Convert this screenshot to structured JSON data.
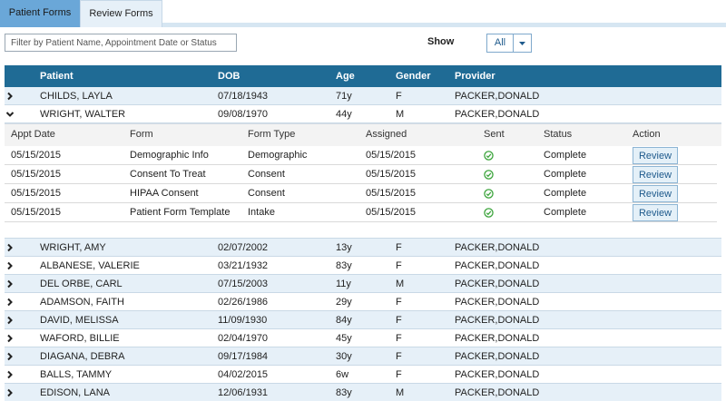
{
  "tabs": [
    {
      "label": "Patient Forms",
      "active": true
    },
    {
      "label": "Review Forms",
      "active": false
    }
  ],
  "filter": {
    "placeholder": "Filter by Patient Name, Appointment Date or Status",
    "value": ""
  },
  "show": {
    "label": "Show",
    "selected": "All"
  },
  "table": {
    "headers": {
      "patient": "Patient",
      "dob": "DOB",
      "age": "Age",
      "gender": "Gender",
      "provider": "Provider"
    },
    "rows_before": [
      {
        "patient": "CHILDS, LAYLA",
        "dob": "07/18/1943",
        "age": "71y",
        "gender": "F",
        "provider": "PACKER,DONALD",
        "expanded": false
      },
      {
        "patient": "WRIGHT, WALTER",
        "dob": "09/08/1970",
        "age": "44y",
        "gender": "M",
        "provider": "PACKER,DONALD",
        "expanded": true
      }
    ],
    "forms": {
      "headers": {
        "appt_date": "Appt Date",
        "form": "Form",
        "form_type": "Form Type",
        "assigned": "Assigned",
        "sent": "Sent",
        "status": "Status",
        "action": "Action"
      },
      "rows": [
        {
          "appt_date": "05/15/2015",
          "form": "Demographic Info",
          "form_type": "Demographic",
          "assigned": "05/15/2015",
          "status": "Complete",
          "action": "Review"
        },
        {
          "appt_date": "05/15/2015",
          "form": "Consent To Treat",
          "form_type": "Consent",
          "assigned": "05/15/2015",
          "status": "Complete",
          "action": "Review"
        },
        {
          "appt_date": "05/15/2015",
          "form": "HIPAA Consent",
          "form_type": "Consent",
          "assigned": "05/15/2015",
          "status": "Complete",
          "action": "Review"
        },
        {
          "appt_date": "05/15/2015",
          "form": "Patient Form Template",
          "form_type": "Intake",
          "assigned": "05/15/2015",
          "status": "Complete",
          "action": "Review"
        }
      ]
    },
    "rows_after": [
      {
        "patient": "WRIGHT, AMY",
        "dob": "02/07/2002",
        "age": "13y",
        "gender": "F",
        "provider": "PACKER,DONALD"
      },
      {
        "patient": "ALBANESE, VALERIE",
        "dob": "03/21/1932",
        "age": "83y",
        "gender": "F",
        "provider": "PACKER,DONALD"
      },
      {
        "patient": "DEL ORBE, CARL",
        "dob": "07/15/2003",
        "age": "11y",
        "gender": "M",
        "provider": "PACKER,DONALD"
      },
      {
        "patient": "ADAMSON, FAITH",
        "dob": "02/26/1986",
        "age": "29y",
        "gender": "F",
        "provider": "PACKER,DONALD"
      },
      {
        "patient": "DAVID, MELISSA",
        "dob": "11/09/1930",
        "age": "84y",
        "gender": "F",
        "provider": "PACKER,DONALD"
      },
      {
        "patient": "WAFORD, BILLIE",
        "dob": "02/04/1970",
        "age": "45y",
        "gender": "F",
        "provider": "PACKER,DONALD"
      },
      {
        "patient": "DIAGANA, DEBRA",
        "dob": "09/17/1984",
        "age": "30y",
        "gender": "F",
        "provider": "PACKER,DONALD"
      },
      {
        "patient": "BALLS, TAMMY",
        "dob": "04/02/2015",
        "age": "6w",
        "gender": "F",
        "provider": "PACKER,DONALD"
      },
      {
        "patient": "EDISON, LANA",
        "dob": "12/06/1931",
        "age": "83y",
        "gender": "M",
        "provider": "PACKER,DONALD"
      }
    ]
  },
  "colors": {
    "header_bg": "#1f6b95",
    "alt_row": "#e6f0f8",
    "sent_check": "#3aa33a",
    "active_tab": "#6aa7d8"
  },
  "icons": {
    "collapsed": "chevron-right-icon",
    "expanded": "chevron-down-icon",
    "sent": "check-circle-icon",
    "dropdown": "caret-down-icon"
  }
}
